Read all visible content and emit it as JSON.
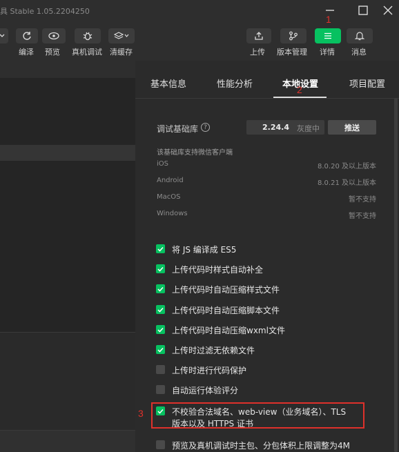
{
  "window": {
    "title": "具 Stable 1.05.2204250"
  },
  "toolbar": {
    "compile_label": "编泽",
    "preview_label": "预览",
    "remote_debug_label": "真机调试",
    "clear_cache_label": "清缓存",
    "upload_label": "上传",
    "version_mgmt_label": "版本管理",
    "details_label": "详情",
    "messages_label": "消息",
    "accent_color": "#07c160"
  },
  "tabs": [
    {
      "label": "基本信息"
    },
    {
      "label": "性能分析"
    },
    {
      "label": "本地设置"
    },
    {
      "label": "项目配置"
    }
  ],
  "annotations": {
    "a1": "1",
    "a2": "2",
    "a3": "3",
    "color": "#e0312b"
  },
  "settings": {
    "lib_label": "调试基础库",
    "lib_version": "2.24.4",
    "lib_usage": "灰度中",
    "push_label": "推送",
    "support_title": "该基础库支持微信客户端",
    "support": [
      {
        "platform": "iOS",
        "value": "8.0.20 及以上版本"
      },
      {
        "platform": "Android",
        "value": "8.0.21 及以上版本"
      },
      {
        "platform": "MacOS",
        "value": "暂不支持"
      },
      {
        "platform": "Windows",
        "value": "暂不支持"
      }
    ],
    "options": [
      {
        "label": "将 JS 编译成 ES5",
        "checked": true
      },
      {
        "label": "上传代码时样式自动补全",
        "checked": true
      },
      {
        "label": "上传代码时自动压缩样式文件",
        "checked": true
      },
      {
        "label": "上传代码时自动压缩脚本文件",
        "checked": true
      },
      {
        "label": "上传代码时自动压缩wxml文件",
        "checked": true
      },
      {
        "label": "上传时过滤无依赖文件",
        "checked": true
      },
      {
        "label": "上传时进行代码保护",
        "checked": false
      },
      {
        "label": "自动运行体验评分",
        "checked": false
      },
      {
        "label": "不校验合法域名、web-view（业务域名）、TLS",
        "label2": "版本以及 HTTPS 证书",
        "checked": true
      },
      {
        "label": "预览及真机调试时主包、分包体积上限调整为4M",
        "checked": false
      }
    ]
  }
}
